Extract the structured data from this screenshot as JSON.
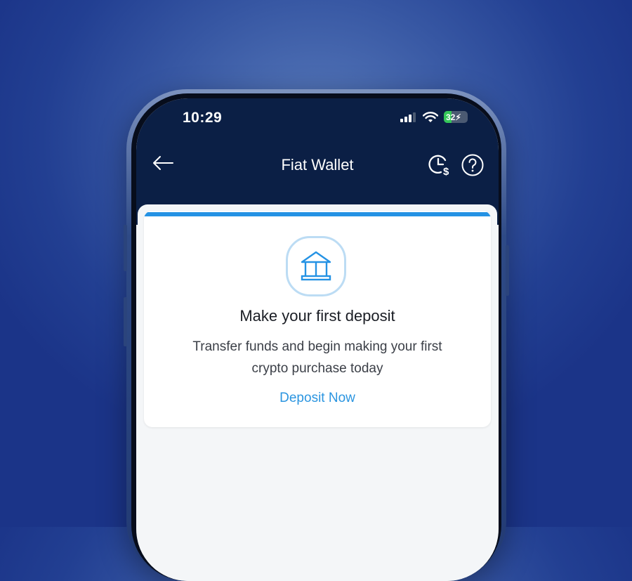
{
  "status_bar": {
    "time": "10:29",
    "battery": "32"
  },
  "header": {
    "title": "Fiat Wallet",
    "back_icon": "arrow-left-icon",
    "history_icon": "clock-dollar-icon",
    "help_icon": "question-circle-icon"
  },
  "card": {
    "icon": "bank-icon",
    "title": "Make your first deposit",
    "description_line1": "Transfer funds and begin making your first",
    "description_line2": "crypto purchase today",
    "cta": "Deposit Now"
  },
  "colors": {
    "header_bg": "#0b1f45",
    "accent": "#2492e4",
    "battery_green": "#35c759"
  }
}
